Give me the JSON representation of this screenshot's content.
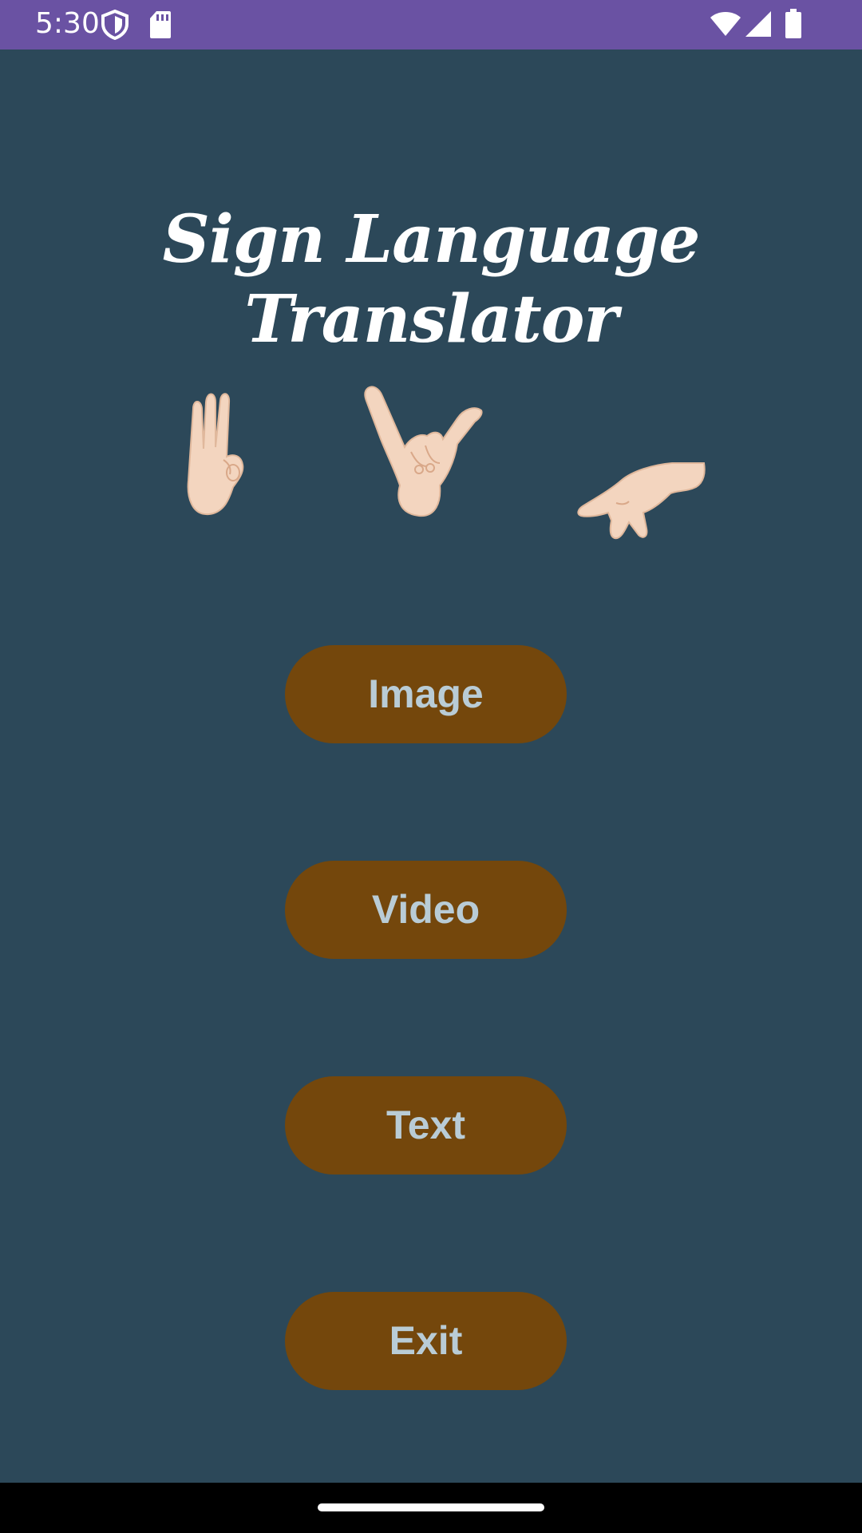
{
  "status_bar": {
    "time": "5:30",
    "background": "#6a52a3",
    "icons_left": [
      "shield-icon",
      "sd-card-icon"
    ],
    "icons_right": [
      "wifi-icon",
      "cellular-signal-icon",
      "battery-icon"
    ]
  },
  "app": {
    "title": "Sign Language Translator",
    "background": "#2c4859",
    "hands": [
      "hand-ok-sign-icon",
      "hand-y-sign-icon",
      "hand-pointing-down-icon"
    ]
  },
  "buttons": {
    "image": "Image",
    "video": "Video",
    "text": "Text",
    "exit": "Exit",
    "background": "#74470c",
    "text_color": "#b9ccd6"
  },
  "nav_bar": {
    "background": "#000000"
  }
}
